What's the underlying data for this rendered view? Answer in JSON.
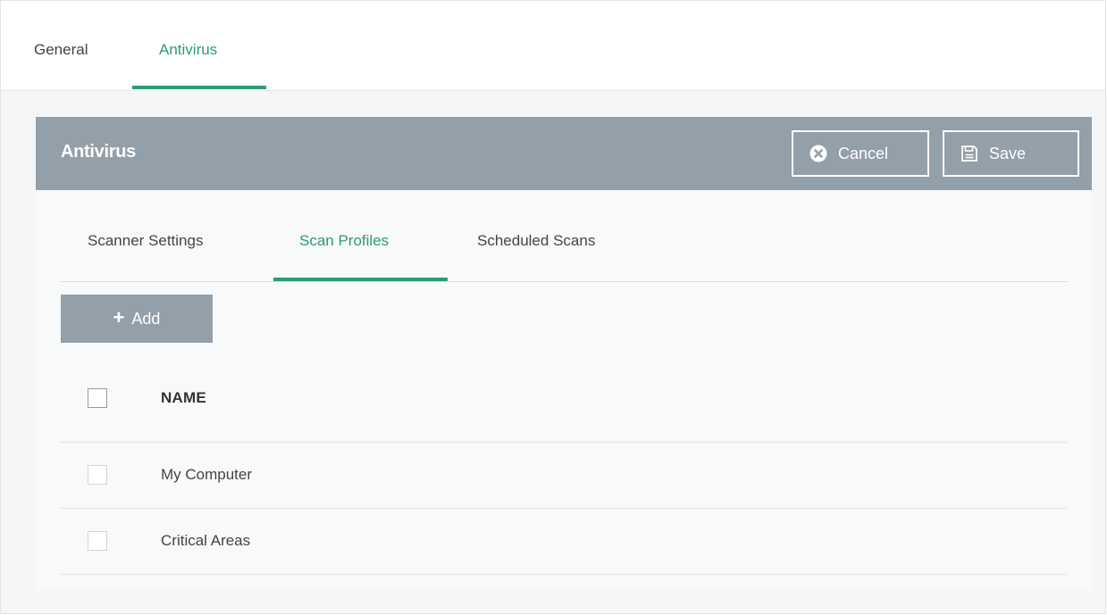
{
  "top_tabs": {
    "general": "General",
    "antivirus": "Antivirus",
    "active": "Antivirus"
  },
  "panel": {
    "title": "Antivirus",
    "cancel_label": "Cancel",
    "save_label": "Save"
  },
  "sub_tabs": {
    "scanner_settings": "Scanner Settings",
    "scan_profiles": "Scan Profiles",
    "scheduled_scans": "Scheduled Scans",
    "active": "Scan Profiles"
  },
  "toolbar": {
    "add_label": "Add"
  },
  "table": {
    "header_name": "NAME",
    "rows": [
      {
        "name": "My Computer",
        "checked": false
      },
      {
        "name": "Critical Areas",
        "checked": false
      }
    ]
  },
  "colors": {
    "accent": "#2a9d73",
    "header_bg": "#939fa9"
  }
}
